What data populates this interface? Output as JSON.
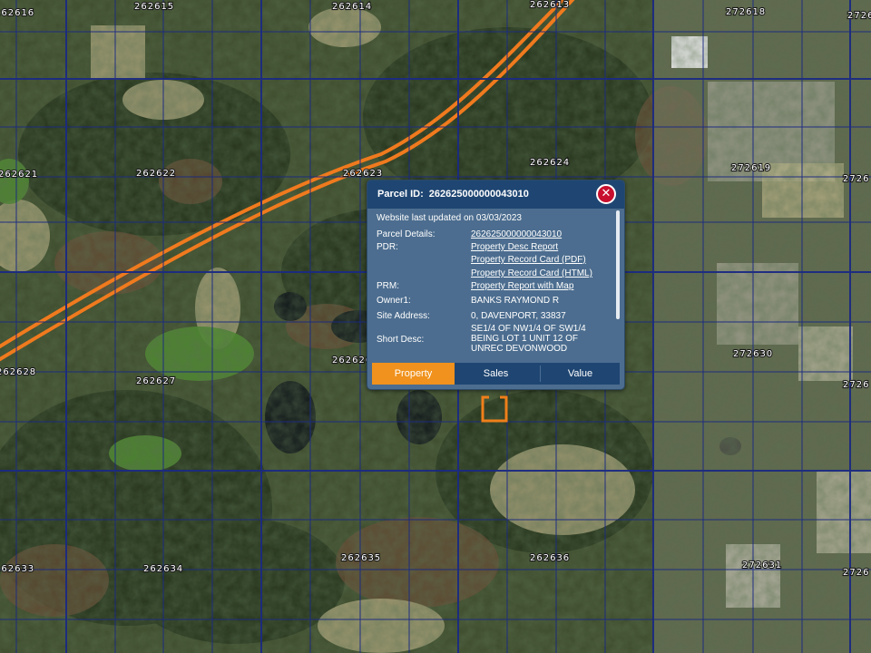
{
  "map": {
    "grid_labels": [
      "262616",
      "262615",
      "262614",
      "262613",
      "272618",
      "2726",
      "262621",
      "262622",
      "262623",
      "262624",
      "272619",
      "2726",
      "262628",
      "262627",
      "262626",
      "272630",
      "2726",
      "262633",
      "262634",
      "262635",
      "262636",
      "272631",
      "2726"
    ],
    "colors": {
      "grid": "#1b2a82",
      "highway": "#f07a1e",
      "marker": "#ef7f1a"
    }
  },
  "popup": {
    "title_prefix": "Parcel ID:",
    "parcel_id": "262625000000043010",
    "close_icon": "close-icon",
    "updated": "Website last updated on 03/03/2023",
    "rows": {
      "parcel_details": {
        "label": "Parcel Details:",
        "value": "262625000000043010"
      },
      "pdr": {
        "label": "PDR:",
        "links": [
          "Property Desc Report",
          "Property Record Card (PDF)",
          "Property Record Card (HTML)"
        ]
      },
      "prm": {
        "label": "PRM:",
        "value": "Property Report with Map"
      },
      "owner": {
        "label": "Owner1:",
        "value": "BANKS RAYMOND R"
      },
      "site_address": {
        "label": "Site Address:",
        "value": "0, DAVENPORT, 33837"
      },
      "short_desc": {
        "label": "Short Desc:",
        "lines": [
          "SE1/4 OF NW1/4 OF SW1/4",
          "BEING LOT 1 UNIT 12 OF",
          "UNREC DEVONWOOD"
        ]
      }
    },
    "tabs": [
      "Property",
      "Sales",
      "Value"
    ],
    "active_tab": "Property"
  }
}
